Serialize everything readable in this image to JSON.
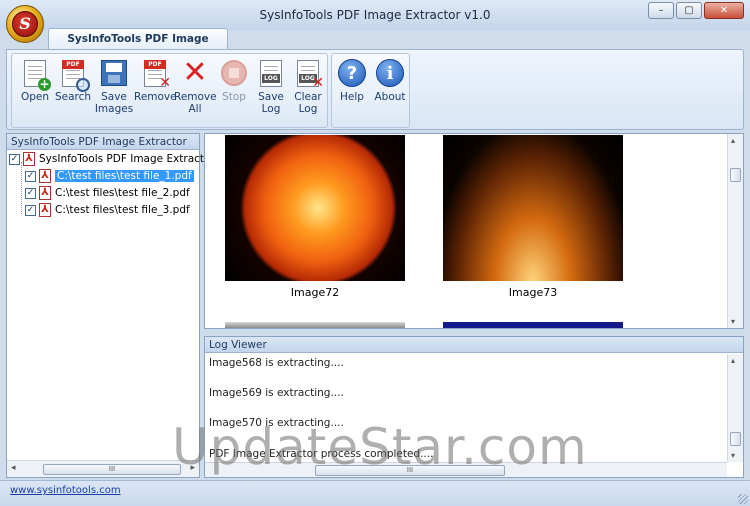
{
  "window": {
    "title": "SysInfoTools PDF Image Extractor v1.0",
    "logo_letter": "S",
    "controls": {
      "minimize": "–",
      "maximize": "▢",
      "close": "✕"
    }
  },
  "ribbon": {
    "tab": "SysInfoTools PDF Image Extractor",
    "buttons": [
      {
        "id": "open",
        "label": "Open",
        "icon": "folder-add-icon",
        "enabled": true
      },
      {
        "id": "search",
        "label": "Search",
        "icon": "pdf-search-icon",
        "enabled": true
      },
      {
        "id": "save-images",
        "label": "Save Images",
        "icon": "save-images-icon",
        "enabled": true
      },
      {
        "id": "remove",
        "label": "Remove",
        "icon": "pdf-remove-icon",
        "enabled": true
      },
      {
        "id": "remove-all",
        "label": "Remove All",
        "icon": "red-x-icon",
        "enabled": true
      },
      {
        "id": "stop",
        "label": "Stop",
        "icon": "stop-icon",
        "enabled": false
      },
      {
        "id": "save-log",
        "label": "Save Log",
        "icon": "save-log-icon",
        "enabled": true
      },
      {
        "id": "clear-log",
        "label": "Clear Log",
        "icon": "clear-log-icon",
        "enabled": true
      },
      {
        "id": "help",
        "label": "Help",
        "icon": "help-icon",
        "enabled": true
      },
      {
        "id": "about",
        "label": "About",
        "icon": "info-icon",
        "enabled": true
      }
    ],
    "badges": {
      "pdf": "PDF",
      "log": "LOG",
      "help": "?",
      "about": "i"
    }
  },
  "tree": {
    "header": "SysInfoTools PDF Image Extractor",
    "root": {
      "label": "SysInfoTools PDF Image Extractor",
      "checked": true
    },
    "files": [
      {
        "label": "C:\\test files\\test file_1.pdf",
        "checked": true,
        "selected": true
      },
      {
        "label": "C:\\test files\\test file_2.pdf",
        "checked": true,
        "selected": false
      },
      {
        "label": "C:\\test files\\test file_3.pdf",
        "checked": true,
        "selected": false
      }
    ],
    "scroll_grip": "III"
  },
  "images": {
    "items": [
      {
        "label": "Image72",
        "subject": "sun"
      },
      {
        "label": "Image73",
        "subject": "solar-loops"
      }
    ]
  },
  "log": {
    "header": "Log Viewer",
    "lines": [
      "Image568 is extracting....",
      "Image569 is extracting....",
      "Image570 is extracting....",
      "PDF Image Extractor process completed...."
    ],
    "scroll_grip": "III"
  },
  "status": {
    "link": "www.sysinfotools.com"
  },
  "watermark": "UpdateStar.com"
}
